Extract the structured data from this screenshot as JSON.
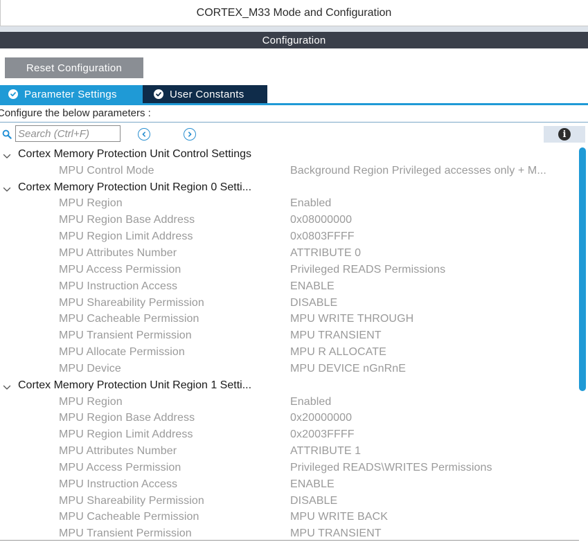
{
  "window": {
    "title": "CORTEX_M33 Mode and Configuration"
  },
  "section": {
    "header": "Configuration"
  },
  "toolbar": {
    "reset_label": "Reset Configuration"
  },
  "tabs": [
    {
      "label": "Parameter Settings",
      "active": true
    },
    {
      "label": "User Constants",
      "active": false
    }
  ],
  "configure_label": "Configure the below parameters :",
  "search": {
    "placeholder": "Search (Ctrl+F)",
    "value": ""
  },
  "groups": [
    {
      "title": "Cortex Memory Protection Unit Control Settings",
      "params": [
        {
          "name": "MPU Control Mode",
          "value": "Background Region Privileged accesses only + M..."
        }
      ]
    },
    {
      "title": "Cortex Memory Protection Unit Region 0 Setti...",
      "params": [
        {
          "name": "MPU Region",
          "value": "Enabled"
        },
        {
          "name": "MPU Region Base Address",
          "value": "0x08000000"
        },
        {
          "name": "MPU Region Limit Address",
          "value": "0x0803FFFF"
        },
        {
          "name": "MPU Attributes Number",
          "value": "ATTRIBUTE 0"
        },
        {
          "name": "MPU Access Permission",
          "value": "Privileged READS Permissions"
        },
        {
          "name": "MPU Instruction Access",
          "value": "ENABLE"
        },
        {
          "name": "MPU Shareability Permission",
          "value": "DISABLE"
        },
        {
          "name": "MPU Cacheable Permission",
          "value": "MPU WRITE THROUGH"
        },
        {
          "name": "MPU Transient Permission",
          "value": "MPU TRANSIENT"
        },
        {
          "name": "MPU Allocate Permission",
          "value": "MPU R ALLOCATE"
        },
        {
          "name": "MPU Device",
          "value": "MPU DEVICE nGnRnE"
        }
      ]
    },
    {
      "title": "Cortex Memory Protection Unit Region 1 Setti...",
      "params": [
        {
          "name": "MPU Region",
          "value": "Enabled"
        },
        {
          "name": "MPU Region Base Address",
          "value": "0x20000000"
        },
        {
          "name": "MPU Region Limit Address",
          "value": "0x2003FFFF"
        },
        {
          "name": "MPU Attributes Number",
          "value": "ATTRIBUTE 1"
        },
        {
          "name": "MPU Access Permission",
          "value": "Privileged READS\\WRITES Permissions"
        },
        {
          "name": "MPU Instruction Access",
          "value": "ENABLE"
        },
        {
          "name": "MPU Shareability Permission",
          "value": "DISABLE"
        },
        {
          "name": "MPU Cacheable Permission",
          "value": "MPU WRITE BACK"
        },
        {
          "name": "MPU Transient Permission",
          "value": "MPU TRANSIENT"
        }
      ]
    }
  ],
  "icons": {
    "search": "search-icon",
    "prev": "chevron-left-circle-icon",
    "next": "chevron-right-circle-icon",
    "info": "info-icon",
    "check": "check-circle-icon",
    "expand": "chevron-down-icon"
  },
  "colors": {
    "accent": "#1f9ad6",
    "tab_inactive": "#0f2c4a",
    "section_header": "#3a3f4a",
    "reset_button": "#8a8e94",
    "param_text": "#9a9a9a"
  }
}
